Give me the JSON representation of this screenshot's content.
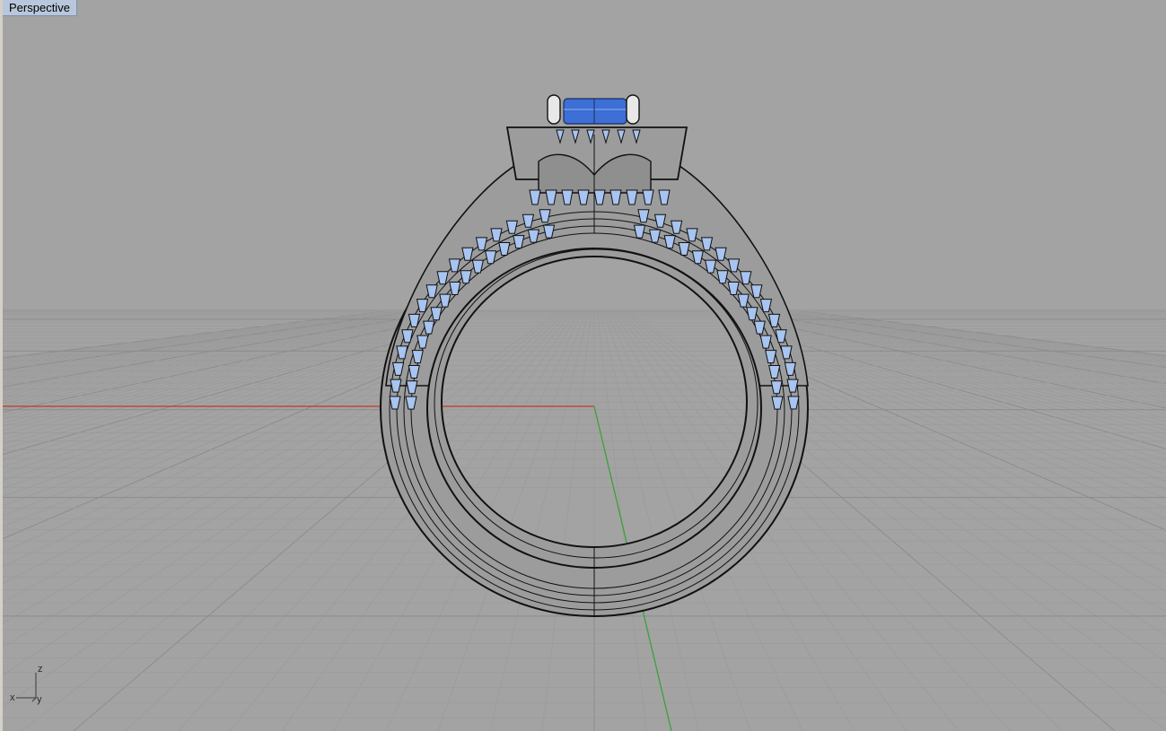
{
  "viewport": {
    "title": "Perspective",
    "background_color": "#a3a3a3",
    "grid_color": "#9a9a9a",
    "grid_major_color": "#8c8c8c",
    "x_axis_color": "#c0392b",
    "y_axis_color": "#3aa13a"
  },
  "model": {
    "wire_color": "#111111",
    "surface_color": "#9c9c9c",
    "stone_color": "#3d6fd6",
    "accent_stone_color": "#a8c4f0",
    "prong_color": "#e8e8e8"
  },
  "axes_widget": {
    "z_label": "z",
    "x_label": "x",
    "y_label": "y"
  }
}
